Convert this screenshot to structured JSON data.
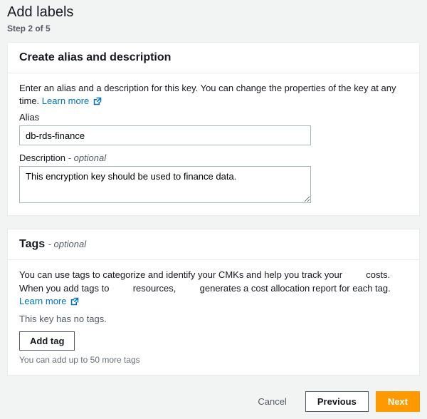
{
  "page": {
    "title": "Add labels",
    "step": "Step 2 of 5"
  },
  "aliasPanel": {
    "heading": "Create alias and description",
    "intro": "Enter an alias and a description for this key. You can change the properties of the key at any time.",
    "learnMore": "Learn more",
    "aliasLabel": "Alias",
    "aliasValue": "db-rds-finance",
    "descLabel": "Description",
    "descOptional": "- optional",
    "descValue": "This encryption key should be used to finance data."
  },
  "tagsPanel": {
    "heading": "Tags",
    "headingOptional": "- optional",
    "intro1": "You can use tags to categorize and identify your CMKs and help you track your ",
    "intro2": " costs. When you add tags to ",
    "intro3": " resources, ",
    "intro4": " generates a cost allocation report for each tag.",
    "learnMore": "Learn more",
    "noTags": "This key has no tags.",
    "addTag": "Add tag",
    "limit": "You can add up to 50 more tags"
  },
  "footer": {
    "cancel": "Cancel",
    "previous": "Previous",
    "next": "Next"
  }
}
